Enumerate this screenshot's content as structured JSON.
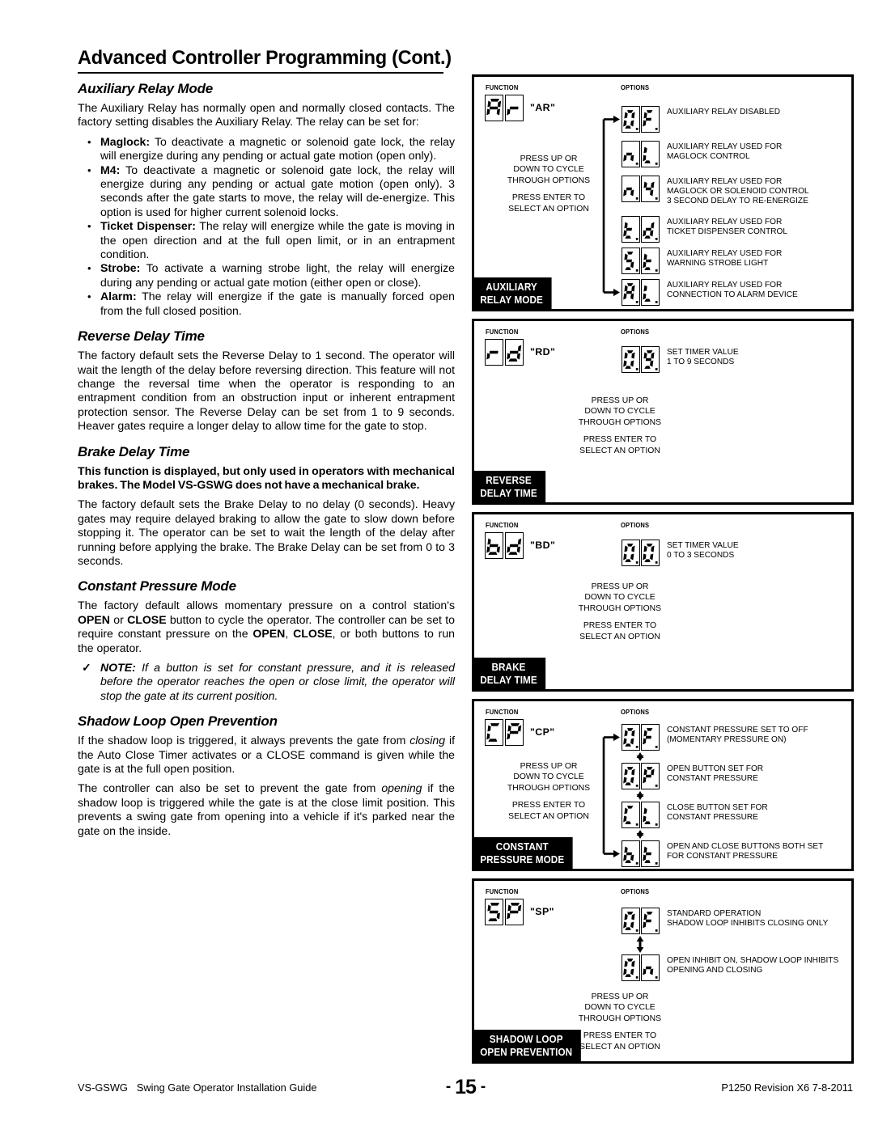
{
  "header": {
    "title": "Advanced Controller Programming (Cont.)"
  },
  "sections": {
    "aux_relay": {
      "heading": "Auxiliary Relay Mode",
      "intro": "The Auxiliary Relay has normally open and normally closed contacts. The factory setting disables the Auxiliary Relay. The relay can be set for:",
      "bullets": [
        {
          "term": "Maglock:",
          "text": " To deactivate a magnetic or solenoid gate lock, the relay will energize during any pending or actual gate motion (open only)."
        },
        {
          "term": "M4:",
          "text": " To deactivate a magnetic or solenoid gate lock, the relay will energize during any pending or actual gate motion (open only). 3 seconds after the gate starts to move, the relay will de-energize. This option is used for higher current solenoid locks."
        },
        {
          "term": "Ticket Dispenser:",
          "text": " The relay will energize while the gate is moving in the open direction and at the full open limit, or in an entrapment condition."
        },
        {
          "term": "Strobe:",
          "text": " To activate a warning strobe light, the relay will energize during any pending or actual gate motion (either open or close)."
        },
        {
          "term": "Alarm:",
          "text": " The relay will energize if the gate is manually forced open from the full closed position."
        }
      ]
    },
    "reverse_delay": {
      "heading": "Reverse Delay Time",
      "para": "The factory default sets the Reverse Delay to 1 second. The operator will wait the length of the delay before reversing direction. This feature will not change the reversal time when the operator is responding to an entrapment condition from an obstruction input or inherent entrapment protection sensor. The Reverse Delay can be set from 1 to 9 seconds. Heaver gates require a longer delay to allow time for the gate to stop."
    },
    "brake_delay": {
      "heading": "Brake Delay Time",
      "bold_para": "This function is displayed, but only used in operators with mechanical brakes. The Model VS-GSWG does not have a mechanical brake.",
      "para": "The factory default sets the Brake Delay to no delay (0 seconds). Heavy gates may require delayed braking to allow the gate to slow down before stopping it. The operator can be set to wait the length of the delay after running before applying the brake. The Brake Delay can be set from 0 to 3 seconds."
    },
    "constant_pressure": {
      "heading": "Constant Pressure Mode",
      "para_1": "The factory default allows momentary pressure on a control station's ",
      "para_1_b1": "OPEN",
      "para_1_mid1": " or ",
      "para_1_b2": "CLOSE",
      "para_1_mid2": " button to cycle the operator. The controller can be set to require constant pressure on the ",
      "para_1_b3": "OPEN",
      "para_1_mid3": ", ",
      "para_1_b4": "CLOSE",
      "para_1_end": ", or both buttons to run the operator.",
      "note_label": "NOTE:",
      "note_text": " If a button is set for constant pressure, and it is released before the operator reaches the open or close limit, the operator will stop the gate at its current position."
    },
    "shadow_loop": {
      "heading": "Shadow Loop Open Prevention",
      "para_1a": "If the shadow loop is triggered, it always prevents the gate from ",
      "para_1_i": "closing",
      "para_1b": " if the Auto Close Timer activates or a CLOSE command is given while the gate is at the full open position.",
      "para_2a": "The controller can also be set to prevent the gate from ",
      "para_2_i": "opening",
      "para_2b": " if the shadow loop is triggered while the gate is at the close limit position. This prevents a swing gate from opening into a vehicle if it's parked near the gate on the inside."
    }
  },
  "diagrams": [
    {
      "id": "auxiliary-relay-mode",
      "function_label": "FUNCTION",
      "options_label": "OPTIONS",
      "code_digits": [
        "A",
        "r"
      ],
      "code_quote": "\"AR\"",
      "tab_lines": [
        "AUXILIARY",
        "RELAY MODE"
      ],
      "instructions": [
        "PRESS UP OR",
        "DOWN TO CYCLE",
        "THROUGH OPTIONS",
        "",
        "PRESS ENTER TO",
        "SELECT AN OPTION"
      ],
      "arrow_style": "loop",
      "options": [
        {
          "digits": [
            "0.",
            "F."
          ],
          "desc": [
            "AUXILIARY RELAY DISABLED"
          ]
        },
        {
          "digits": [
            "n.",
            "L."
          ],
          "desc": [
            "AUXILIARY RELAY USED FOR",
            "MAGLOCK CONTROL"
          ]
        },
        {
          "digits": [
            "n.",
            "4."
          ],
          "desc": [
            "AUXILIARY RELAY USED FOR",
            "MAGLOCK OR SOLENOID CONTROL",
            "3 SECOND DELAY TO RE-ENERGIZE"
          ]
        },
        {
          "digits": [
            "t.",
            "d."
          ],
          "desc": [
            "AUXILIARY RELAY USED FOR",
            "TICKET DISPENSER CONTROL"
          ]
        },
        {
          "digits": [
            "5.",
            "t."
          ],
          "desc": [
            "AUXILIARY RELAY USED FOR",
            "WARNING STROBE LIGHT"
          ]
        },
        {
          "digits": [
            "A.",
            "L."
          ],
          "desc": [
            "AUXILIARY RELAY USED FOR",
            "CONNECTION TO ALARM DEVICE"
          ]
        }
      ]
    },
    {
      "id": "reverse-delay-time",
      "function_label": "FUNCTION",
      "options_label": "OPTIONS",
      "code_digits": [
        "r",
        "d"
      ],
      "code_quote": "\"RD\"",
      "tab_lines": [
        "REVERSE",
        "DELAY TIME"
      ],
      "instructions": [
        "PRESS UP OR",
        "DOWN TO CYCLE",
        "THROUGH OPTIONS",
        "",
        "PRESS ENTER TO",
        "SELECT AN OPTION"
      ],
      "arrow_style": "none",
      "options": [
        {
          "digits": [
            "0.",
            "9."
          ],
          "desc": [
            "SET TIMER VALUE",
            "1 TO 9 SECONDS"
          ]
        }
      ]
    },
    {
      "id": "brake-delay-time",
      "function_label": "FUNCTION",
      "options_label": "OPTIONS",
      "code_digits": [
        "b",
        "d"
      ],
      "code_quote": "\"BD\"",
      "tab_lines": [
        "BRAKE",
        "DELAY TIME"
      ],
      "instructions": [
        "PRESS UP OR",
        "DOWN TO CYCLE",
        "THROUGH OPTIONS",
        "",
        "PRESS ENTER TO",
        "SELECT AN OPTION"
      ],
      "arrow_style": "none",
      "options": [
        {
          "digits": [
            "0.",
            "0."
          ],
          "desc": [
            "SET TIMER VALUE",
            "0 TO 3 SECONDS"
          ]
        }
      ]
    },
    {
      "id": "constant-pressure-mode",
      "function_label": "FUNCTION",
      "options_label": "OPTIONS",
      "code_digits": [
        "C",
        "P"
      ],
      "code_quote": "\"CP\"",
      "tab_lines": [
        "CONSTANT",
        "PRESSURE MODE"
      ],
      "instructions": [
        "PRESS UP OR",
        "DOWN TO CYCLE",
        "THROUGH OPTIONS",
        "",
        "PRESS ENTER TO",
        "SELECT AN OPTION"
      ],
      "arrow_style": "loop-double",
      "options": [
        {
          "digits": [
            "0.",
            "F."
          ],
          "desc": [
            "CONSTANT PRESSURE SET TO OFF",
            "(MOMENTARY PRESSURE ON)"
          ]
        },
        {
          "digits": [
            "0.",
            "P."
          ],
          "desc": [
            "OPEN BUTTON SET FOR",
            "CONSTANT PRESSURE"
          ]
        },
        {
          "digits": [
            "C.",
            "L."
          ],
          "desc": [
            "CLOSE BUTTON SET FOR",
            "CONSTANT PRESSURE"
          ]
        },
        {
          "digits": [
            "b.",
            "t."
          ],
          "desc": [
            "OPEN AND CLOSE BUTTONS BOTH SET",
            "FOR CONSTANT PRESSURE"
          ]
        }
      ]
    },
    {
      "id": "shadow-loop-open-prevention",
      "function_label": "FUNCTION",
      "options_label": "OPTIONS",
      "code_digits": [
        "5",
        "P"
      ],
      "code_quote": "\"SP\"",
      "tab_lines": [
        "SHADOW LOOP",
        "OPEN PREVENTION"
      ],
      "instructions": [
        "PRESS UP OR",
        "DOWN TO CYCLE",
        "THROUGH OPTIONS",
        "",
        "PRESS ENTER TO",
        "SELECT AN OPTION"
      ],
      "arrow_style": "double-only",
      "options": [
        {
          "digits": [
            "0.",
            "F."
          ],
          "desc": [
            "STANDARD OPERATION",
            "SHADOW LOOP INHIBITS CLOSING ONLY"
          ]
        },
        {
          "digits": [
            "0.",
            "n."
          ],
          "desc": [
            "OPEN INHIBIT ON, SHADOW LOOP INHIBITS",
            "OPENING AND CLOSING"
          ]
        }
      ]
    }
  ],
  "footer": {
    "model": "VS-GSWG",
    "guide": "Swing Gate Operator Installation Guide",
    "page_number": "15",
    "revision": "P1250 Revision X6 7-8-2011"
  }
}
